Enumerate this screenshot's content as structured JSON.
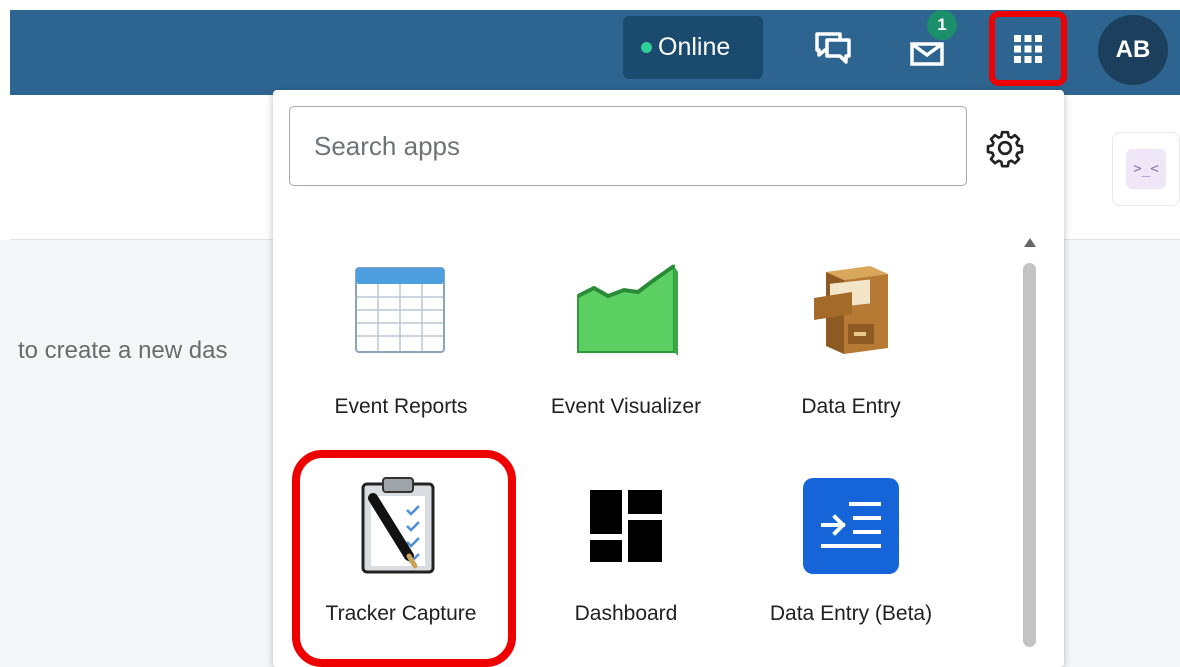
{
  "header": {
    "status_label": "Online",
    "status_color": "#2fcf9a",
    "notification_count": "1",
    "avatar_initials": "AB",
    "icons": [
      "chat-icon",
      "mail-icon",
      "apps-grid-icon"
    ]
  },
  "background": {
    "text": "to create a new das"
  },
  "menu": {
    "search_placeholder": "Search apps",
    "apps": [
      {
        "label": "Event Reports",
        "icon": "table-icon"
      },
      {
        "label": "Event Visualizer",
        "icon": "area-chart-icon"
      },
      {
        "label": "Data Entry",
        "icon": "file-cabinet-icon"
      },
      {
        "label": "Tracker Capture",
        "icon": "clipboard-pen-icon"
      },
      {
        "label": "Dashboard",
        "icon": "dashboard-blocks-icon"
      },
      {
        "label": "Data Entry (Beta)",
        "icon": "data-entry-beta-icon"
      }
    ]
  },
  "highlight_color": "#ee0000"
}
